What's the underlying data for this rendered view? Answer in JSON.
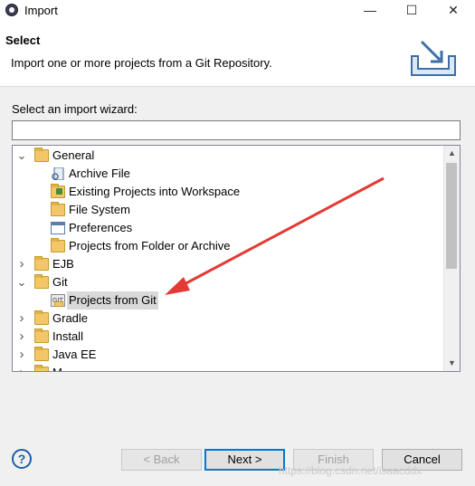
{
  "window": {
    "title": "Import",
    "minimize_glyph": "—",
    "maximize_glyph": "☐",
    "close_glyph": "✕"
  },
  "header": {
    "title": "Select",
    "description": "Import one or more projects from a Git Repository."
  },
  "wizard": {
    "label": "Select an import wizard:",
    "filter_value": "",
    "tree": [
      {
        "label": "General",
        "level": 0,
        "expanded": true,
        "icon": "folder-icon"
      },
      {
        "label": "Archive File",
        "level": 1,
        "icon": "archive-file-icon"
      },
      {
        "label": "Existing Projects into Workspace",
        "level": 1,
        "icon": "existing-projects-icon"
      },
      {
        "label": "File System",
        "level": 1,
        "icon": "folder-icon"
      },
      {
        "label": "Preferences",
        "level": 1,
        "icon": "preferences-icon"
      },
      {
        "label": "Projects from Folder or Archive",
        "level": 1,
        "icon": "folder-icon"
      },
      {
        "label": "EJB",
        "level": 0,
        "expanded": false,
        "icon": "folder-icon"
      },
      {
        "label": "Git",
        "level": 0,
        "expanded": true,
        "icon": "folder-icon"
      },
      {
        "label": "Projects from Git",
        "level": 1,
        "icon": "git-icon",
        "selected": true
      },
      {
        "label": "Gradle",
        "level": 0,
        "expanded": false,
        "icon": "folder-icon"
      },
      {
        "label": "Install",
        "level": 0,
        "expanded": false,
        "icon": "folder-icon"
      },
      {
        "label": "Java EE",
        "level": 0,
        "expanded": false,
        "icon": "folder-icon"
      },
      {
        "label": "M",
        "level": 0,
        "expanded": false,
        "icon": "folder-icon"
      }
    ]
  },
  "buttons": {
    "help": "?",
    "back": "< Back",
    "next": "Next >",
    "finish": "Finish",
    "cancel": "Cancel"
  },
  "watermark": "https://blog.csdn.net/isaacddx",
  "colors": {
    "accent": "#0078d7",
    "arrow": "#e53935",
    "selection": "#d9d9d9"
  }
}
